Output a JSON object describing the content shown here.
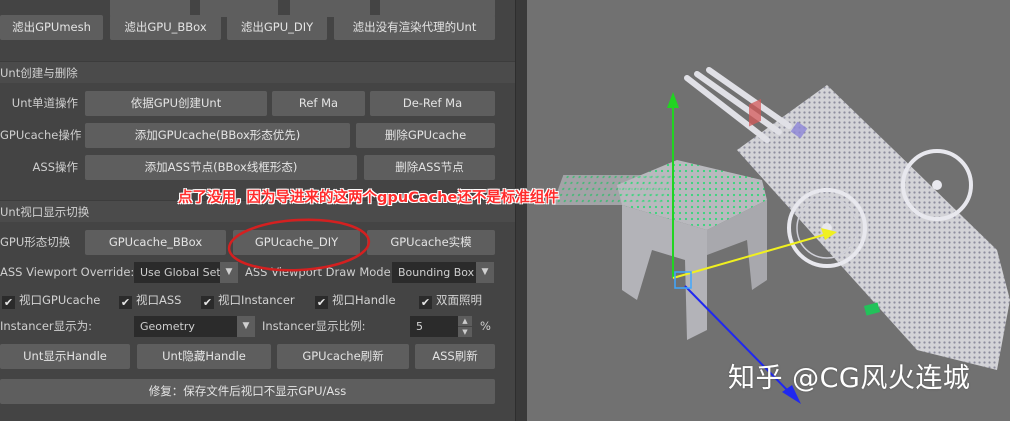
{
  "top_row": {
    "button_1": "滤出GPUmesh",
    "button_2": "滤出GPU_BBox",
    "button_3": "滤出GPU_DIY",
    "button_4": "滤出没有渲染代理的Unt"
  },
  "unt_section": {
    "title": "Unt创建与删除",
    "row1": {
      "label": "Unt单道操作",
      "btn_a": "依据GPU创建Unt",
      "btn_b": "Ref Ma",
      "btn_c": "De-Ref Ma"
    },
    "row2": {
      "label": "GPUcache操作",
      "btn_a": "添加GPUcache(BBox形态优先)",
      "btn_b": "删除GPUcache"
    },
    "row3": {
      "label": "ASS操作",
      "btn_a": "添加ASS节点(BBox线框形态)",
      "btn_b": "删除ASS节点"
    }
  },
  "view_section": {
    "title": "Unt视口显示切换",
    "gpu_row": {
      "label": "GPU形态切换",
      "btn_a": "GPUcache_BBox",
      "btn_b": "GPUcache_DIY",
      "btn_c": "GPUcache实模"
    },
    "ass_override": {
      "label": "ASS Viewport Override:",
      "value": "Use Global Sett"
    },
    "ass_draw_mode": {
      "label": "ASS Viewport Draw Mode:",
      "value": "Bounding Box"
    },
    "checkboxes": [
      {
        "label": "视口GPUcache",
        "checked": true
      },
      {
        "label": "视口ASS",
        "checked": true
      },
      {
        "label": "视口Instancer",
        "checked": true
      },
      {
        "label": "视口Handle",
        "checked": true
      },
      {
        "label": "双面照明",
        "checked": true
      }
    ],
    "instancer_display": {
      "label": "Instancer显示为:",
      "value": "Geometry"
    },
    "instancer_ratio": {
      "label": "Instancer显示比例:",
      "value": "5",
      "unit": "%"
    },
    "bottom_buttons": {
      "show_handle": "Unt显示Handle",
      "hide_handle": "Unt隐藏Handle",
      "gpu_refresh": "GPUcache刷新",
      "ass_refresh": "ASS刷新"
    },
    "fix_button": "修复：保存文件后视口不显示GPU/Ass"
  },
  "annotation": "点了没用, 因为导进来的这两个gpuCache还不是标准组件",
  "watermark": "知乎 @CG风火连城",
  "colors": {
    "panel_bg": "#444444",
    "button_bg": "#5e5e5e",
    "viewport_bg": "#717171",
    "annotation_red": "#ff2c2c",
    "circle_red": "#d42020"
  }
}
